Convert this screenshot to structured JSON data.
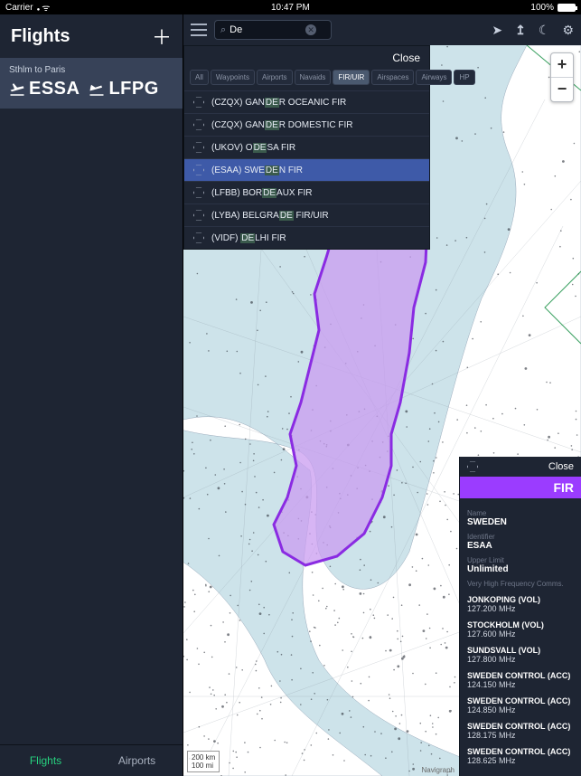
{
  "status": {
    "carrier": "Carrier",
    "time": "10:47 PM",
    "battery": "100%"
  },
  "sidebar": {
    "title": "Flights",
    "route_label": "Sthlm to Paris",
    "dep": "ESSA",
    "arr": "LFPG",
    "tabs": {
      "flights": "Flights",
      "airports": "Airports"
    }
  },
  "toolbar": {
    "search_value": "De",
    "icons": {
      "loc": "location-arrow-icon",
      "up": "upload-icon",
      "moon": "moon-icon",
      "gear": "gear-icon"
    }
  },
  "searchPanel": {
    "close": "Close",
    "filters": [
      "All",
      "Waypoints",
      "Airports",
      "Navaids",
      "FIR/UIR",
      "Airspaces",
      "Airways",
      "HP"
    ],
    "filter_selected_index": 4,
    "results": [
      {
        "pre": "(CZQX) GAN",
        "hl": "DE",
        "post": "R OCEANIC FIR"
      },
      {
        "pre": "(CZQX) GAN",
        "hl": "DE",
        "post": "R DOMESTIC FIR"
      },
      {
        "pre": "(UKOV) O",
        "hl": "DE",
        "post": "SA FIR"
      },
      {
        "pre": "(ESAA) SWE",
        "hl": "DE",
        "post": "N FIR"
      },
      {
        "pre": "(LFBB) BOR",
        "hl": "DE",
        "post": "AUX FIR"
      },
      {
        "pre": "(LYBA) BELGRA",
        "hl": "DE",
        "post": " FIR/UIR"
      },
      {
        "pre": "(VIDF) ",
        "hl": "DE",
        "post": "LHI FIR"
      }
    ],
    "selected_result_index": 3
  },
  "info": {
    "close": "Close",
    "band": "FIR",
    "fields": {
      "name_label": "Name",
      "name": "SWEDEN",
      "ident_label": "Identifier",
      "ident": "ESAA",
      "upper_label": "Upper Limit",
      "upper": "Unlimited",
      "vhf_label": "Very High Frequency Comms."
    },
    "freqs": [
      {
        "name": "JONKOPING (VOL)",
        "mhz": "127.200 MHz"
      },
      {
        "name": "STOCKHOLM (VOL)",
        "mhz": "127.600 MHz"
      },
      {
        "name": "SUNDSVALL (VOL)",
        "mhz": "127.800 MHz"
      },
      {
        "name": "SWEDEN CONTROL (ACC)",
        "mhz": "124.150 MHz"
      },
      {
        "name": "SWEDEN CONTROL (ACC)",
        "mhz": "124.850 MHz"
      },
      {
        "name": "SWEDEN CONTROL (ACC)",
        "mhz": "128.175 MHz"
      },
      {
        "name": "SWEDEN CONTROL (ACC)",
        "mhz": "128.625 MHz"
      }
    ]
  },
  "scale": {
    "top": "200 km",
    "bottom": "100 mi"
  },
  "credit": "Navigraph",
  "colors": {
    "fir_fill": "#c99cf0",
    "fir_stroke": "#8a2be2",
    "sea": "#cde3ea",
    "land": "#ffffff"
  }
}
